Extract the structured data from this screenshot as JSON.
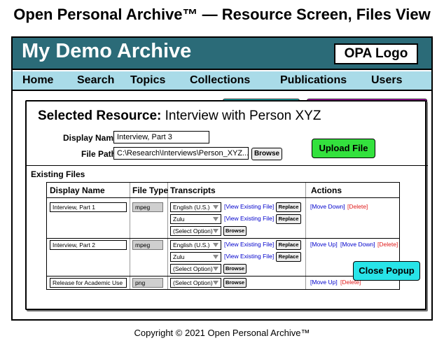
{
  "page_title": "Open Personal Archive™ — Resource Screen, Files View",
  "header": {
    "app_name": "My Demo Archive",
    "logo": "OPA Logo"
  },
  "nav": {
    "items": [
      "Home",
      "Search",
      "Topics",
      "Collections",
      "Publications",
      "Users"
    ]
  },
  "popup": {
    "heading_label": "Selected Resource:",
    "heading_value": "Interview with Person XYZ",
    "display_name_label": "Display Name",
    "display_name_value": "Interview, Part 3",
    "file_path_label": "File Path",
    "file_path_value": "C:\\Research\\Interviews\\Person_XYZ...",
    "browse_label": "Browse",
    "upload_label": "Upload File",
    "existing_files_label": "Existing Files",
    "close_label": "Close Popup"
  },
  "table": {
    "headers": [
      "Display Name",
      "File Type",
      "Transcripts",
      "Actions"
    ],
    "rows": [
      {
        "name": "Interview, Part 1",
        "type": "mpeg",
        "transcripts": [
          {
            "lang": "English (U.S.)",
            "view": "[View Existing File]",
            "replace": "Replace"
          },
          {
            "lang": "Zulu",
            "view": "[View Existing File]",
            "replace": "Replace"
          }
        ],
        "new_option": "(Select Option)",
        "browse": "Browse",
        "actions": [
          "[Move Down]",
          "[Delete]"
        ]
      },
      {
        "name": "Interview, Part 2",
        "type": "mpeg",
        "transcripts": [
          {
            "lang": "English (U.S.)",
            "view": "[View Existing File]",
            "replace": "Replace"
          },
          {
            "lang": "Zulu",
            "view": "[View Existing File]",
            "replace": "Replace"
          }
        ],
        "new_option": "(Select Option)",
        "browse": "Browse",
        "actions": [
          "[Move Up]",
          "[Move Down]",
          "[Delete]"
        ]
      },
      {
        "name": "Release for Academic Use",
        "type": "png",
        "new_option": "(Select Option)",
        "browse": "Browse",
        "actions": [
          "[Move Up]",
          "[Delete]"
        ]
      }
    ]
  },
  "colors": {
    "header_bg": "#2b6b78",
    "nav_bg": "#a9dbe8",
    "upload_button": "#33e13d",
    "close_button": "#28e4e8",
    "link": "#0000cc",
    "delete_link": "#e01919"
  },
  "copyright": "Copyright © 2021 Open Personal Archive™"
}
